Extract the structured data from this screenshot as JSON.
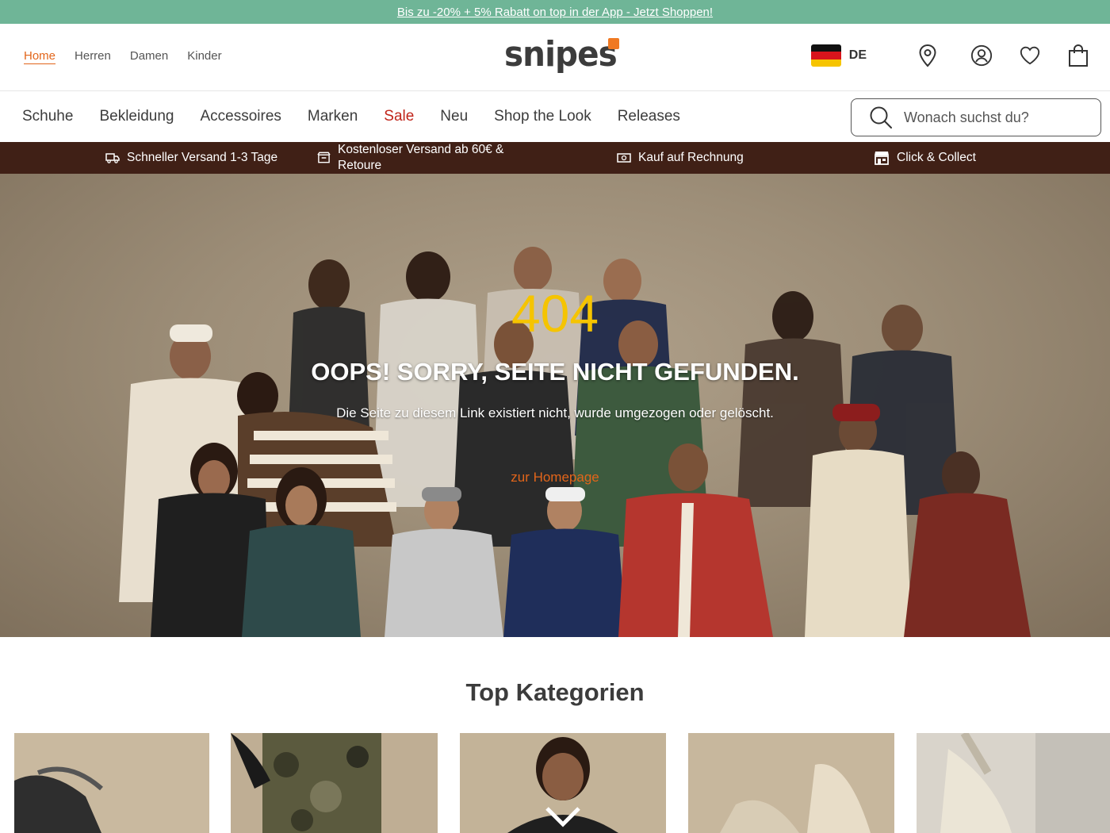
{
  "promo": {
    "text": "Bis zu -20% + 5% Rabatt on top in der App - Jetzt Shoppen!"
  },
  "header": {
    "gender_nav": [
      "Home",
      "Herren",
      "Damen",
      "Kinder"
    ],
    "logo_text": "snipes",
    "language": "DE",
    "icons": [
      "store-locator-icon",
      "account-icon",
      "wishlist-icon",
      "cart-icon"
    ]
  },
  "nav": {
    "categories": [
      "Schuhe",
      "Bekleidung",
      "Accessoires",
      "Marken",
      "Sale",
      "Neu",
      "Shop the Look",
      "Releases"
    ],
    "search_placeholder": "Wonach suchst du?"
  },
  "usp": [
    {
      "icon": "truck-icon",
      "text": "Schneller Versand 1-3 Tage"
    },
    {
      "icon": "return-box-icon",
      "text": "Kostenloser Versand ab 60€ & Retoure"
    },
    {
      "icon": "cash-icon",
      "text": "Kauf auf Rechnung"
    },
    {
      "icon": "store-icon",
      "text": "Click & Collect"
    }
  ],
  "error": {
    "code": "404",
    "title": "OOPS! SORRY, SEITE NICHT GEFUNDEN.",
    "description": "Die Seite zu diesem Link existiert nicht, wurde umgezogen oder gelöscht.",
    "link": "zur Homepage"
  },
  "top_categories": {
    "title": "Top Kategorien"
  },
  "colors": {
    "promo_bg": "#6fb597",
    "usp_bg": "#402016",
    "accent": "#e2651a",
    "sale": "#c0241a",
    "error_code": "#f5c400",
    "logo_dot": "#f07922"
  }
}
